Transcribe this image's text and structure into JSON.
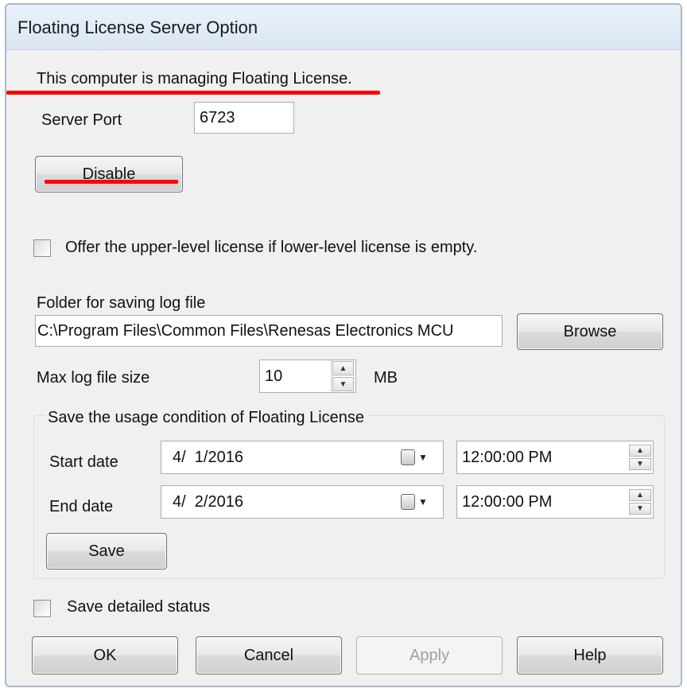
{
  "window": {
    "title": "Floating License Server Option"
  },
  "status": {
    "message": "This computer is managing Floating License."
  },
  "server_port": {
    "label": "Server Port",
    "value": "6723"
  },
  "disable_button": {
    "label": "Disable"
  },
  "offer_upper_level": {
    "label": "Offer the upper-level license if lower-level license is empty.",
    "checked": false
  },
  "log_folder": {
    "label": "Folder for saving log file",
    "value": "C:\\Program Files\\Common Files\\Renesas Electronics MCU",
    "browse_label": "Browse"
  },
  "max_log_size": {
    "label": "Max log file size",
    "value": "10",
    "unit": "MB"
  },
  "usage_group": {
    "title": "Save the usage condition of Floating License",
    "start_label": "Start date",
    "start_date": "4/  1/2016",
    "start_time": "12:00:00 PM",
    "end_label": "End date",
    "end_date": "4/  2/2016",
    "end_time": "12:00:00 PM",
    "save_label": "Save"
  },
  "detailed_status": {
    "label": "Save detailed status",
    "checked": false
  },
  "footer": {
    "ok_label": "OK",
    "cancel_label": "Cancel",
    "apply_label": "Apply",
    "help_label": "Help"
  },
  "colors": {
    "annotation_red": "#ff0000",
    "title_bar": "#dbe6f4",
    "dialog_bg": "#f0f0f0"
  },
  "icons": {
    "calendar": "calendar-icon",
    "dropdown": "chevron-down-icon",
    "spin_up": "arrow-up-icon",
    "spin_down": "arrow-down-icon"
  }
}
